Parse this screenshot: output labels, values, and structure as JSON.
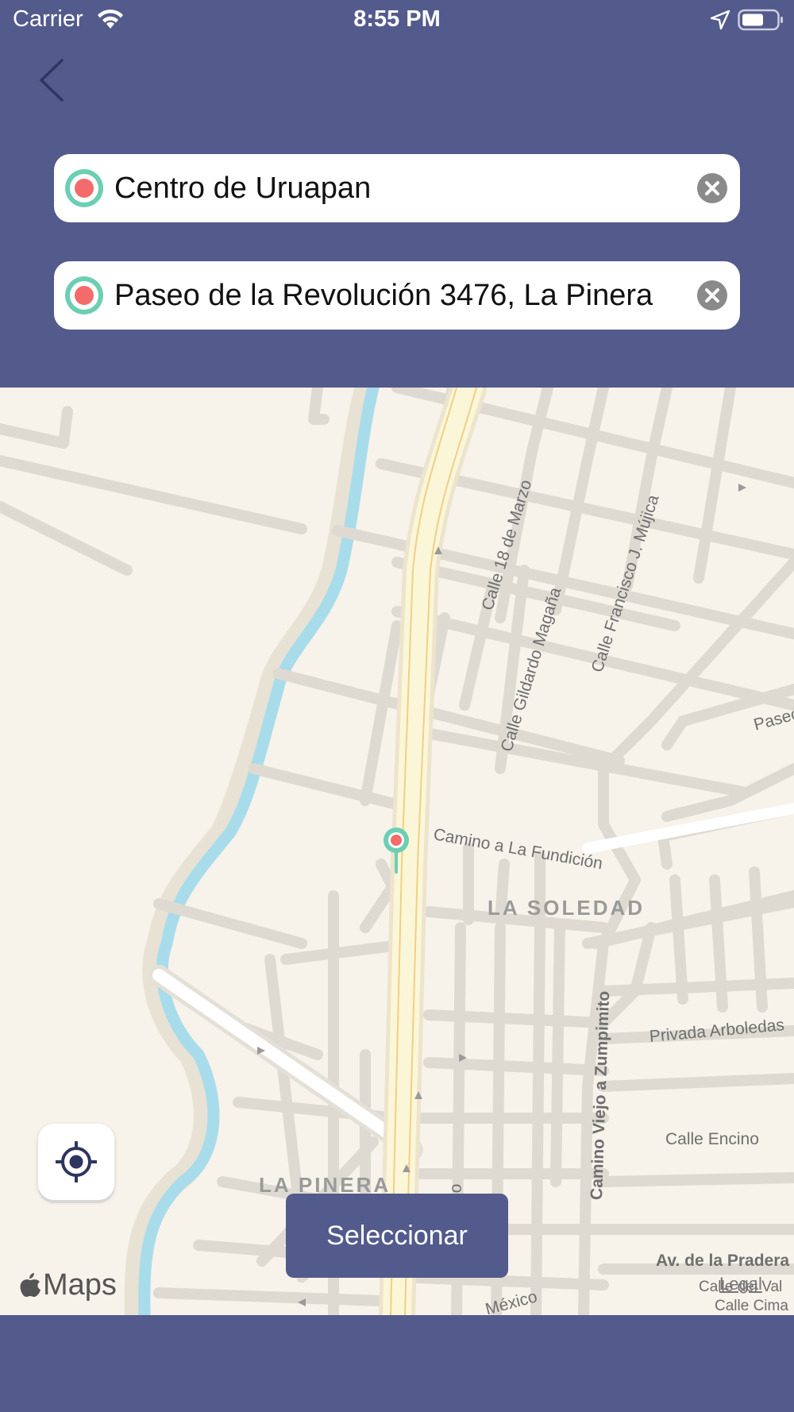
{
  "status_bar": {
    "carrier": "Carrier",
    "time": "8:55 PM"
  },
  "origin_field": {
    "value": "Centro de Uruapan"
  },
  "destination_field": {
    "value": "Paseo de la Revolución 3476, La Pinera"
  },
  "map": {
    "labels": {
      "calle_18_marzo": "Calle 18 de Marzo",
      "calle_francisco": "Calle Francisco J. Mújica",
      "calle_gildardo": "Calle Gildardo Magaña",
      "paseo": "Paseo",
      "camino_fundicion": "Camino a La Fundición",
      "camino_viejo": "Camino Viejo a Zumpimito",
      "privada_arboledas": "Privada Arboledas",
      "calle_encino": "Calle Encino",
      "av_pradera": "Av. de la Pradera",
      "calle_del_val": "Calle del Val",
      "calle_cima": "Calle Cima",
      "mexico": "México",
      "no_fragment": "no"
    },
    "districts": {
      "la_soledad": "LA SOLEDAD",
      "la_pinera": "LA PINERA"
    },
    "attribution": "Maps",
    "legal": "Legal"
  },
  "select_button": {
    "label": "Seleccionar"
  },
  "colors": {
    "brand": "#535a8c",
    "pin_ring": "#6ccfb3",
    "pin_center": "#f46b6b",
    "map_bg": "#f7f2ea",
    "river": "#a8dcea"
  }
}
